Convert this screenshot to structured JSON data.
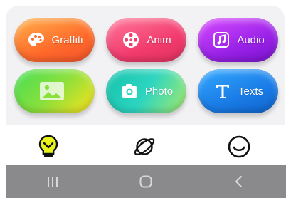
{
  "tiles": [
    {
      "id": "graffiti",
      "label": "Graffiti",
      "icon": "palette-icon"
    },
    {
      "id": "anim",
      "label": "Anim",
      "icon": "film-reel-icon"
    },
    {
      "id": "audio",
      "label": "Audio",
      "icon": "music-note-icon"
    },
    {
      "id": "image",
      "label": "",
      "icon": "image-icon"
    },
    {
      "id": "photo",
      "label": "Photo",
      "icon": "camera-icon"
    },
    {
      "id": "texts",
      "label": "Texts",
      "icon": "text-t-icon"
    }
  ],
  "bottom_bar": [
    "lightbulb-icon",
    "planet-icon",
    "smiley-icon"
  ],
  "system_nav": [
    "recent-apps-icon",
    "home-icon",
    "back-icon"
  ],
  "colors": {
    "bulb": "#e6f21a",
    "navbar": "#8a8a8d"
  }
}
